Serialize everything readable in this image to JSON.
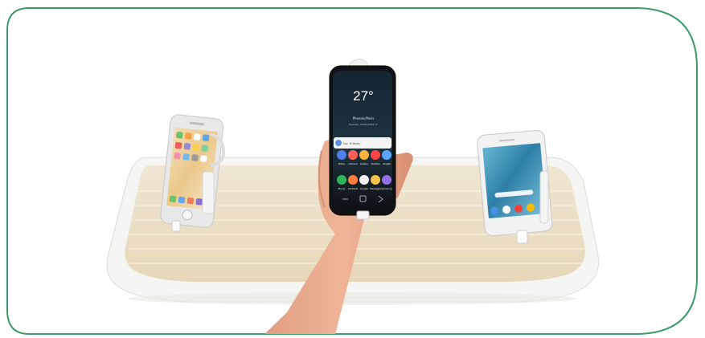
{
  "image": {
    "subject": "Retail phone display counter with three secured smartphones",
    "center_phone_screen": {
      "temperature": "27°",
      "location": "Phoenix/Paris",
      "date": "Tuesday, 22/01/2019 17",
      "search_placeholder": "Say 'Hi Bixby'",
      "apps_row1": [
        "Bixby",
        "Camera",
        "Gallery",
        "YouTube",
        "Google"
      ],
      "apps_row2": [
        "Phone",
        "Contacts",
        "Google",
        "Messages",
        "Samsung"
      ]
    }
  },
  "colors": {
    "frame_green": "#3d9b67",
    "base_white": "#f6f6f4",
    "wood": "#eadcc0",
    "skin": "#e9a98c",
    "phone_black": "#121212",
    "iphone_silver": "#e7e7e7",
    "pixel_white": "#f3f3f3",
    "wallpaper_blue": "#5ea6c9"
  }
}
